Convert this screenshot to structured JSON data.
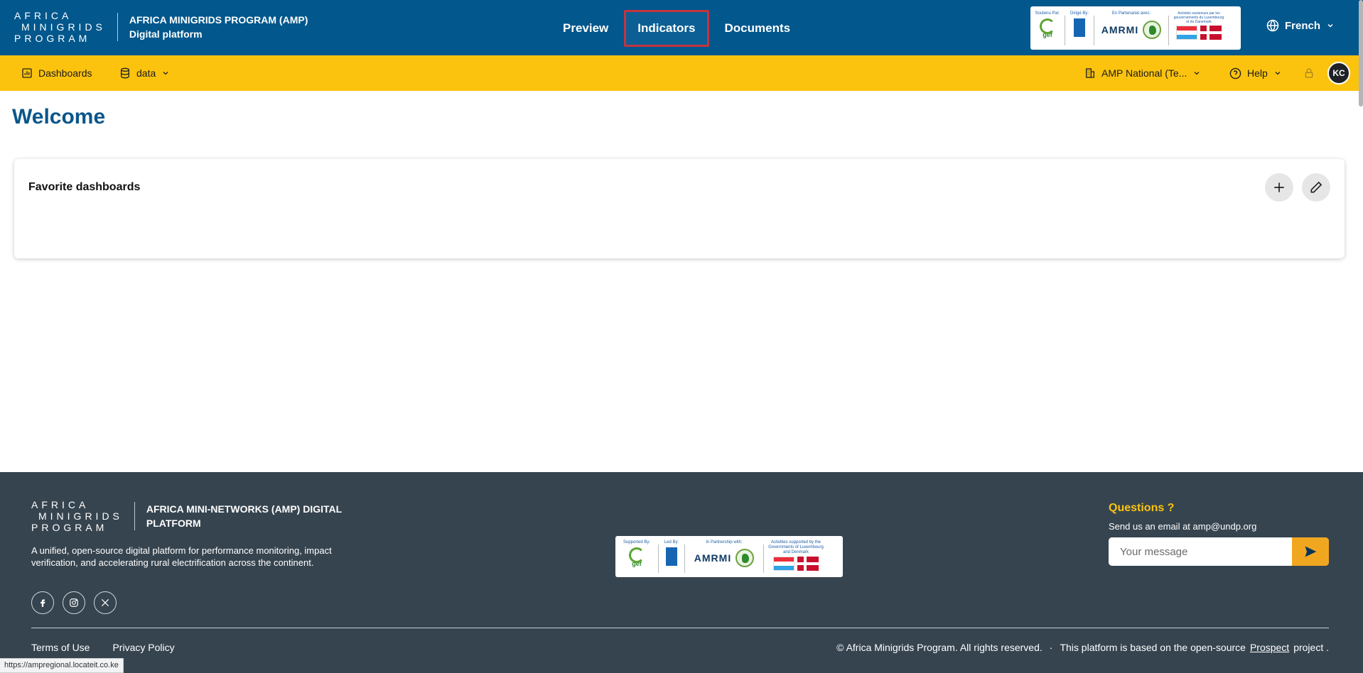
{
  "header": {
    "logo_lines": [
      "AFRICA",
      "MINIGRIDS",
      "PROGRAM"
    ],
    "title_line1": "AFRICA MINIGRIDS PROGRAM (AMP)",
    "title_line2": "Digital platform",
    "nav": [
      {
        "label": "Preview",
        "active": false
      },
      {
        "label": "Indicators",
        "active": true
      },
      {
        "label": "Documents",
        "active": false
      }
    ],
    "partners": {
      "supported_label": "Soutenu Par:",
      "led_label": "Dirigé By:",
      "partnership_label": "En Partenariat avec:",
      "activities_label": "Activités soutenues par les gouvernements du Luxembourg et du Danemark",
      "gef": "gef",
      "armi": "AMRMI"
    },
    "language": "French"
  },
  "subbar": {
    "dashboards": "Dashboards",
    "data": "data",
    "organization": "AMP National (Te...",
    "help": "Help",
    "avatar_initials": "KC"
  },
  "main": {
    "welcome": "Welcome",
    "favorites_title": "Favorite dashboards"
  },
  "footer": {
    "logo_lines": [
      "AFRICA",
      "MINIGRIDS",
      "PROGRAM"
    ],
    "title": "AFRICA MINI-NETWORKS (AMP) DIGITAL PLATFORM",
    "description": "A unified, open-source digital platform for performance monitoring, impact verification, and accelerating rural electrification across the continent.",
    "partners": {
      "supported_label": "Supported By:",
      "led_label": "Led By:",
      "partnership_label": "In Partnership with:",
      "activities_label": "Activities supported by the Governments of Luxembourg and Denmark",
      "gef": "gef",
      "armi": "AMRMI"
    },
    "questions": "Questions ?",
    "email_text": "Send us an email at amp@undp.org",
    "message_placeholder": "Your message",
    "links": [
      "Terms of Use",
      "Privacy Policy"
    ],
    "copyright": "© Africa Minigrids Program. All rights reserved.",
    "separator": "·",
    "based_on_prefix": "This platform is based on the open-source",
    "based_on_link": "Prospect",
    "based_on_suffix": "project ."
  },
  "status_url": "https://ampregional.locateit.co.ke",
  "colors": {
    "header_blue": "#02578c",
    "accent_yellow": "#fcc30e",
    "footer_slate": "#36444f",
    "send_orange": "#f0a71f",
    "active_outline": "#c6343e"
  }
}
